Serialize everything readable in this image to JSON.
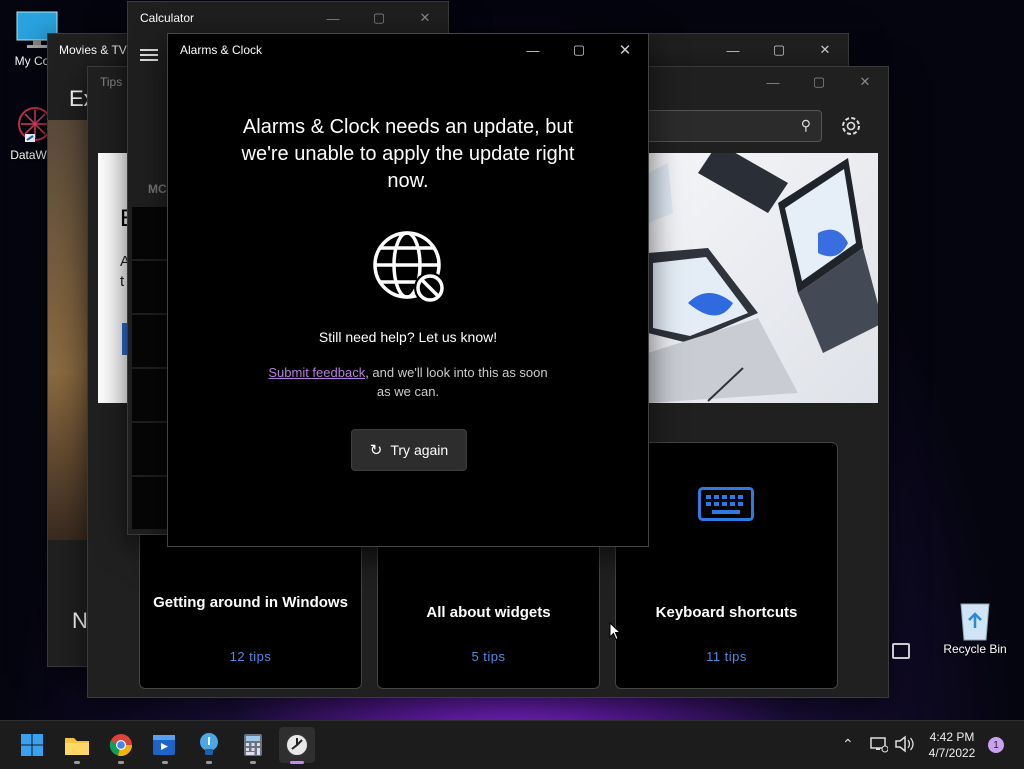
{
  "desktop": {
    "icons": [
      {
        "label": "My Com",
        "icon": "monitor-icon"
      },
      {
        "label": "DataWag",
        "icon": "datawagon-icon"
      },
      {
        "label": "Recycle Bin",
        "icon": "recycle-bin-icon"
      }
    ]
  },
  "windows": {
    "calculator": {
      "title": "Calculator",
      "side_label": "MC"
    },
    "movies": {
      "title": "Movies & TV",
      "heading_fragment": "Ex",
      "fragment_n": "N"
    },
    "tips": {
      "title": "Tips",
      "banner_fragments": [
        "E",
        "A",
        "t"
      ],
      "cards": [
        {
          "title": "Getting around in Windows",
          "count": "12 tips"
        },
        {
          "title": "All about widgets",
          "count": "5 tips"
        },
        {
          "title": "Keyboard shortcuts",
          "count": "11 tips"
        }
      ]
    },
    "alarms": {
      "title": "Alarms & Clock",
      "message": "Alarms & Clock needs an update, but we're unable to apply the update right now.",
      "help": "Still need help? Let us know!",
      "feedback_link": "Submit feedback",
      "feedback_rest": ", and we'll look into this as soon as we can.",
      "retry_label": "Try again"
    }
  },
  "taskbar": {
    "apps": [
      {
        "name": "start",
        "icon": "windows-start-icon"
      },
      {
        "name": "file-explorer",
        "icon": "folder-icon"
      },
      {
        "name": "chrome",
        "icon": "chrome-icon"
      },
      {
        "name": "movies-tv",
        "icon": "movies-icon"
      },
      {
        "name": "tips",
        "icon": "lightbulb-icon"
      },
      {
        "name": "calculator",
        "icon": "calculator-icon"
      },
      {
        "name": "alarms-clock",
        "icon": "clock-icon",
        "active": true
      }
    ],
    "time": "4:42 PM",
    "date": "4/7/2022",
    "notification_count": "1"
  },
  "colors": {
    "accent_link": "#b57edc",
    "tip_count": "#4c8be6",
    "active_indicator": "#c58af9"
  }
}
